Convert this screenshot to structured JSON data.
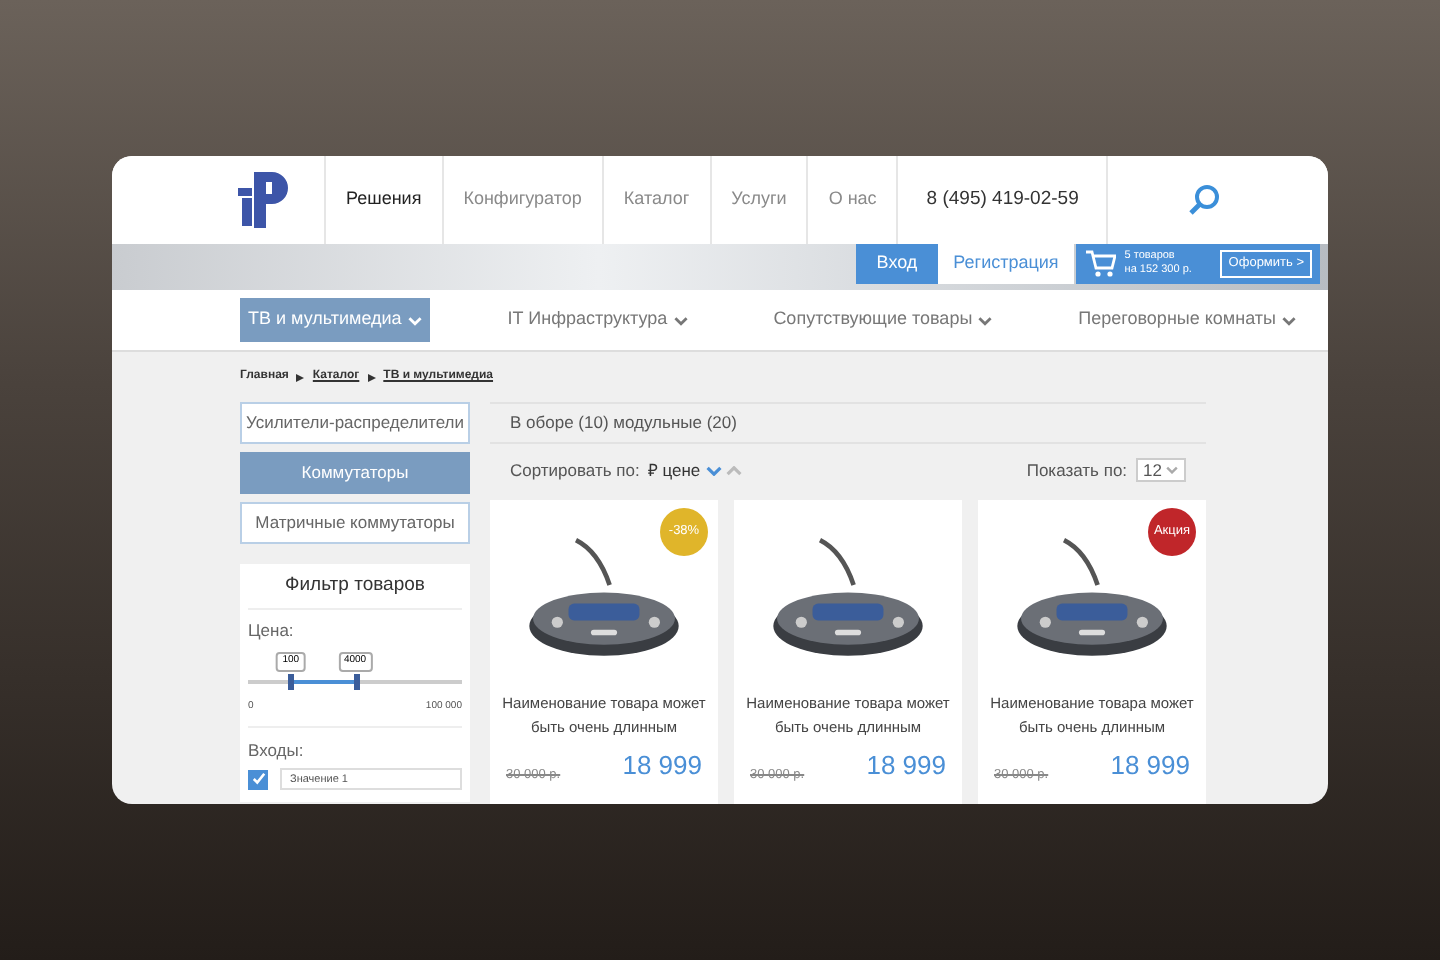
{
  "header": {
    "nav": [
      {
        "label": "Решения",
        "selected": true
      },
      {
        "label": "Конфигуратор",
        "selected": false
      },
      {
        "label": "Каталог",
        "selected": false
      },
      {
        "label": "Услуги",
        "selected": false
      },
      {
        "label": "О нас",
        "selected": false
      }
    ],
    "phone": "8 (495) 419-02-59"
  },
  "account": {
    "login": "Вход",
    "register": "Регистрация",
    "cart_count": "5 товаров",
    "cart_total": "на 152 300 р.",
    "checkout": "Оформить >"
  },
  "categories": [
    {
      "label": "ТВ и мультимедиа",
      "selected": true
    },
    {
      "label": "IT Инфраструктура",
      "selected": false
    },
    {
      "label": "Сопутствующие товары",
      "selected": false
    },
    {
      "label": "Переговорные комнаты",
      "selected": false
    }
  ],
  "breadcrumbs": [
    "Главная",
    "Каталог",
    "ТВ и мультимедиа"
  ],
  "subcategories": [
    {
      "label": "Усилители-распределители",
      "selected": false
    },
    {
      "label": "Коммутаторы",
      "selected": true
    },
    {
      "label": "Матричные коммутаторы",
      "selected": false
    }
  ],
  "filter": {
    "title": "Фильтр товаров",
    "price_label": "Цена:",
    "range": {
      "low": {
        "level": 0.2,
        "reading": "100"
      },
      "high": {
        "level": 0.5,
        "reading": "4000"
      },
      "min": "0",
      "max": "100 000"
    },
    "inputs_label": "Входы:",
    "options": [
      {
        "value": "Значение 1",
        "checked": true
      }
    ]
  },
  "content": {
    "heading": "В оборе (10) модульные (20)",
    "sort_label": "Сортировать по:",
    "sort_field": "₽ цене",
    "sort_desc": true,
    "show_label": "Показать по:",
    "show_value": "12"
  },
  "products": [
    {
      "name": "Наименование товара может быть очень длинным",
      "old_price": "30 000 р.",
      "price": "18 999",
      "badge": {
        "kind": "discount",
        "text": "-38%"
      }
    },
    {
      "name": "Наименование товара может быть очень длинным",
      "old_price": "30 000 р.",
      "price": "18 999"
    },
    {
      "name": "Наименование товара может быть очень длинным",
      "old_price": "30 000 р.",
      "price": "18 999",
      "badge": {
        "kind": "promo",
        "text": "Акция"
      }
    }
  ]
}
